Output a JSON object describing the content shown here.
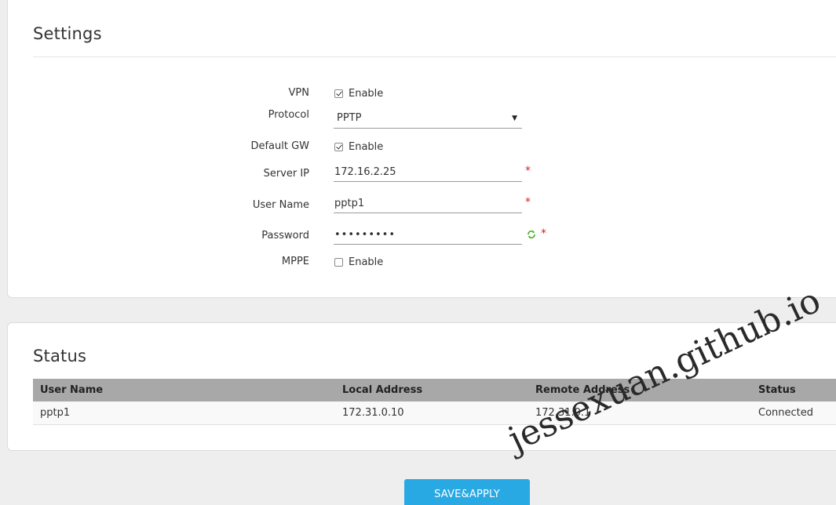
{
  "settings": {
    "title": "Settings",
    "vpn": {
      "label": "VPN",
      "checkbox_label": "Enable",
      "checked": true
    },
    "protocol": {
      "label": "Protocol",
      "value": "PPTP",
      "arrow": "▼"
    },
    "default_gw": {
      "label": "Default GW",
      "checkbox_label": "Enable",
      "checked": true
    },
    "server_ip": {
      "label": "Server IP",
      "value": "172.16.2.25",
      "required_mark": "*"
    },
    "user_name": {
      "label": "User Name",
      "value": "pptp1",
      "required_mark": "*"
    },
    "password": {
      "label": "Password",
      "value": "pptp12345",
      "required_mark": "*",
      "icon": "refresh-icon"
    },
    "mppe": {
      "label": "MPPE",
      "checkbox_label": "Enable",
      "checked": false
    }
  },
  "status": {
    "title": "Status",
    "columns": [
      "User Name",
      "Local Address",
      "Remote Address",
      "Status"
    ],
    "rows": [
      [
        "pptp1",
        "172.31.0.10",
        "172.31.0.1",
        "Connected"
      ]
    ]
  },
  "actions": {
    "save_label": "SAVE&APPLY"
  },
  "watermark": "jessexuan.github.io",
  "colors": {
    "accent": "#29a9e4",
    "required": "#e02020",
    "table_header": "#a8a8a8",
    "page_bg": "#eeeeee"
  }
}
